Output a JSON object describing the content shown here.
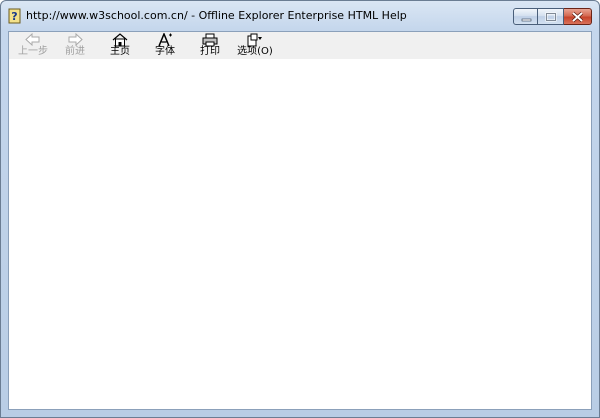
{
  "window": {
    "title": "http://www.w3school.com.cn/ - Offline Explorer Enterprise HTML Help"
  },
  "caption_buttons": {
    "minimize_icon": "minimize-icon",
    "maximize_icon": "restore-icon",
    "close_icon": "close-icon"
  },
  "toolbar": {
    "back_label": "上一步",
    "forward_label": "前进",
    "home_label": "主页",
    "font_label": "字体",
    "print_label": "打印",
    "options_label": "选项(O)"
  },
  "colors": {
    "close_button": "#c7432a",
    "titlebar": "#c4d6ec",
    "toolbar": "#f0f0f0",
    "disabled_text": "#a0a0a0"
  }
}
